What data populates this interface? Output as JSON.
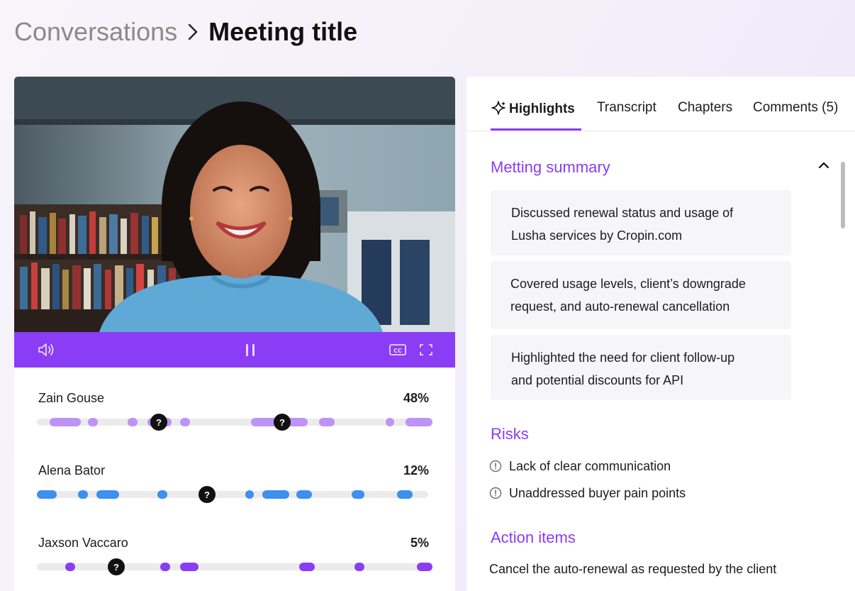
{
  "breadcrumb": {
    "parent": "Conversations",
    "current": "Meeting title"
  },
  "video": {
    "controls": {
      "volume_icon": "speaker-icon",
      "pause_icon": "pause-icon",
      "captions_icon": "cc-icon",
      "fullscreen_icon": "fullscreen-icon"
    }
  },
  "speakers": [
    {
      "name": "Zain Gouse",
      "percent": "48%",
      "color": "#bd93f5"
    },
    {
      "name": "Alena Bator",
      "percent": "12%",
      "color": "#3d8ff0"
    },
    {
      "name": "Jaxson Vaccaro",
      "percent": "5%",
      "color": "#8b3cf5"
    }
  ],
  "tabs": [
    {
      "label": "Highlights",
      "icon": "sparkle-icon",
      "active": true
    },
    {
      "label": "Transcript",
      "active": false
    },
    {
      "label": "Chapters",
      "active": false
    },
    {
      "label": "Comments (5)",
      "active": false
    }
  ],
  "summary": {
    "title": "Metting summary",
    "cards": [
      {
        "line1": "Discussed renewal status and usage of",
        "line2": "Lusha services by Cropin.com"
      },
      {
        "line1": "Covered  usage levels, client’s downgrade",
        "line2": "request, and auto-renewal cancellation"
      },
      {
        "line1": "Highlighted the need for client follow-up",
        "line2": "and potential discounts for API"
      }
    ]
  },
  "risks": {
    "title": "Risks",
    "items": [
      "Lack of clear communication",
      "Unaddressed buyer pain points"
    ]
  },
  "actions": {
    "title": "Action items",
    "items": [
      "Cancel the auto-renewal as requested by the client"
    ]
  },
  "colors": {
    "accent": "#8b3cf5",
    "question_marker": "#111111"
  }
}
